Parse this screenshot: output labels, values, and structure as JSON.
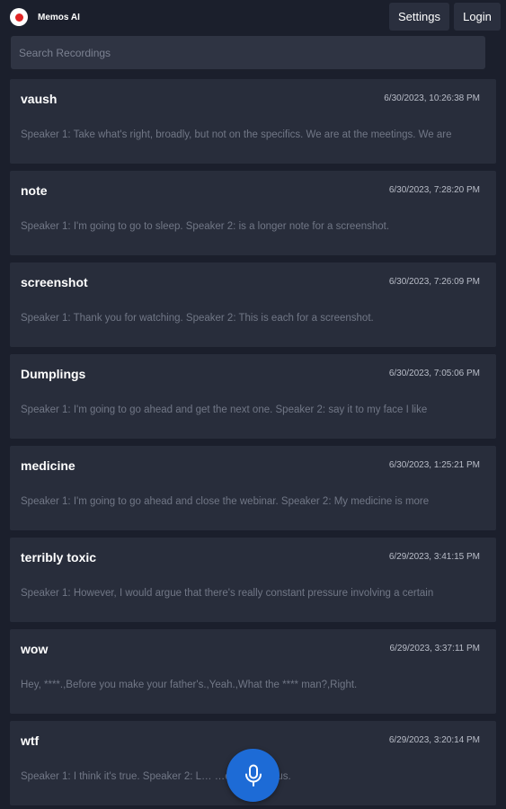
{
  "header": {
    "app_title": "Memos AI",
    "settings_label": "Settings",
    "login_label": "Login",
    "record_icon": "record-icon"
  },
  "search": {
    "placeholder": "Search Recordings",
    "value": ""
  },
  "recordings": [
    {
      "title": "vaush",
      "date": "6/30/2023, 10:26:38 PM",
      "snippet": "Speaker 1: Take what's right, broadly, but not on the specifics. We are at the meetings. We are"
    },
    {
      "title": "note",
      "date": "6/30/2023, 7:28:20 PM",
      "snippet": "Speaker 1: I'm going to go to sleep. Speaker 2: is a longer note for a screenshot."
    },
    {
      "title": "screenshot",
      "date": "6/30/2023, 7:26:09 PM",
      "snippet": "Speaker 1: Thank you for watching. Speaker 2: This is each for a screenshot."
    },
    {
      "title": "Dumplings",
      "date": "6/30/2023, 7:05:06 PM",
      "snippet": "Speaker 1: I'm going to go ahead and get the next one. Speaker 2: say it to my face I like"
    },
    {
      "title": "medicine",
      "date": "6/30/2023, 1:25:21 PM",
      "snippet": "Speaker 1: I'm going to go ahead and close the webinar. Speaker 2: My medicine is more"
    },
    {
      "title": "terribly toxic",
      "date": "6/29/2023, 3:41:15 PM",
      "snippet": "Speaker 1: However, I would argue that there's really constant pressure involving a certain"
    },
    {
      "title": "wow",
      "date": "6/29/2023, 3:37:11 PM",
      "snippet": "Hey, ****.,Before you make your father's.,Yeah.,What the **** man?,Right."
    },
    {
      "title": "wtf",
      "date": "6/29/2023, 3:20:14 PM",
      "snippet": "Speaker 1: I think it's true. Speaker 2: L… …eme is. Jesus."
    }
  ],
  "mic": {
    "icon": "microphone-icon"
  },
  "colors": {
    "background": "#1b1f2c",
    "card": "#282d3b",
    "accent": "#1d6bd6",
    "record_red": "#e02424"
  }
}
